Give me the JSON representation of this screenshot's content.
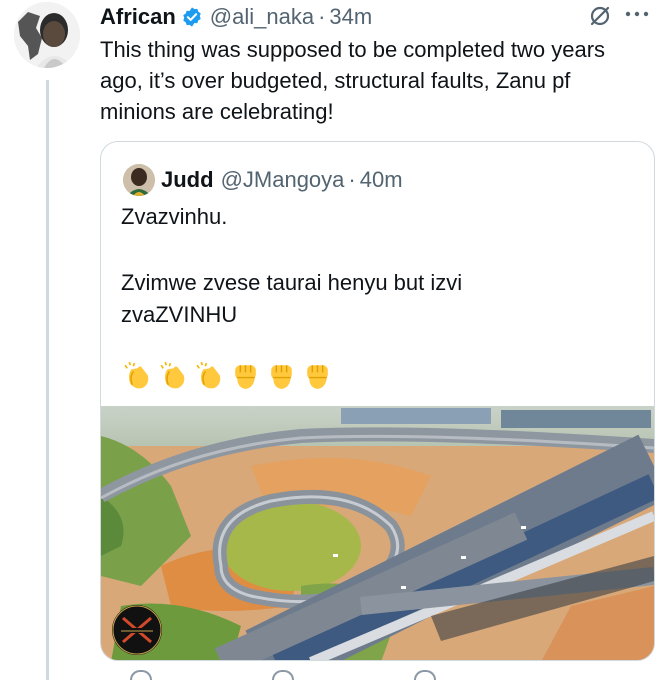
{
  "tweet": {
    "author_name": "African",
    "handle": "@ali_naka",
    "separator": "·",
    "time": "34m",
    "text": "This thing was supposed to be completed two years ago, it’s over budgeted, structural faults, Zanu pf minions are celebrating!"
  },
  "quoted_tweet": {
    "author_name": "Judd",
    "handle": "@JMangoya",
    "separator": "·",
    "time": "40m",
    "line1": "Zvazvinhu.",
    "line2": "Zvimwe zvese taurai henyu but izvi",
    "line3": "zvaZVINHU",
    "emojis": [
      "clapping-hands",
      "clapping-hands",
      "clapping-hands",
      "raised-fist",
      "raised-fist",
      "raised-fist"
    ],
    "media": "aerial-interchange-photo"
  },
  "icons": {
    "verified": "verified-badge-icon",
    "grok": "grok-icon",
    "more": "more-icon"
  },
  "colors": {
    "verified_blue": "#1d9bf0",
    "secondary_text": "#536471",
    "border": "#cfd9de"
  }
}
